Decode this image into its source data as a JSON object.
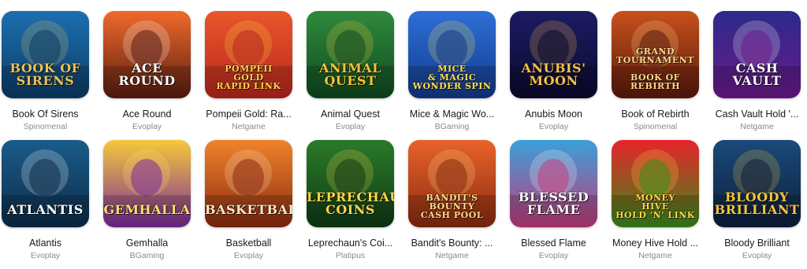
{
  "games": [
    {
      "title": "Book Of Sirens",
      "provider": "Spinomenal",
      "art": "BOOK OF SIRENS",
      "colors": [
        "#1c6fb0",
        "#0a3c66",
        "#e8c15a"
      ]
    },
    {
      "title": "Ace Round",
      "provider": "Evoplay",
      "art": "ACE\nROUND",
      "colors": [
        "#f06a2b",
        "#5a1c10",
        "#ffffff"
      ]
    },
    {
      "title": "Pompeii Gold: Ra...",
      "provider": "Netgame",
      "art": "POMPEII\nGOLD\nRAPID LINK",
      "colors": [
        "#e9572a",
        "#b8261e",
        "#ffd54a"
      ]
    },
    {
      "title": "Animal Quest",
      "provider": "Evoplay",
      "art": "ANIMAL\nQUEST",
      "colors": [
        "#2f8a3c",
        "#0f4a20",
        "#f6c33a"
      ]
    },
    {
      "title": "Mice & Magic Wo...",
      "provider": "BGaming",
      "art": "MICE\n& MAGIC\nWONDER SPIN",
      "colors": [
        "#2d6fd8",
        "#123a8a",
        "#ffe14d"
      ]
    },
    {
      "title": "Anubis Moon",
      "provider": "Evoplay",
      "art": "ANUBIS'\nMOON",
      "colors": [
        "#1d1b63",
        "#0a0a2e",
        "#f5c146"
      ]
    },
    {
      "title": "Book of Rebirth",
      "provider": "Spinomenal",
      "art": "GRAND TOURNAMENT\n\nBOOK OF\nREBIRTH",
      "colors": [
        "#c7501c",
        "#5a1a0c",
        "#ffd98a"
      ]
    },
    {
      "title": "Cash Vault Hold '...",
      "provider": "Netgame",
      "art": "CASH VAULT",
      "colors": [
        "#2b2a8a",
        "#6a1a8a",
        "#ffffff"
      ]
    },
    {
      "title": "Atlantis",
      "provider": "Evoplay",
      "art": "ATLANTIS",
      "colors": [
        "#1a5c8a",
        "#0c2c4a",
        "#ffffff"
      ]
    },
    {
      "title": "Gemhalla",
      "provider": "BGaming",
      "art": "GEMHALLA",
      "colors": [
        "#f5c93a",
        "#7a2a9a",
        "#ffe06a"
      ]
    },
    {
      "title": "Basketball",
      "provider": "Evoplay",
      "art": "BASKETBALL",
      "colors": [
        "#f0832a",
        "#8a2a10",
        "#ffe7c2"
      ]
    },
    {
      "title": "Leprechaun's Coi...",
      "provider": "Platipus",
      "art": "LEPRECHAUN'S\nCOINS",
      "colors": [
        "#2a7a2a",
        "#0e3a14",
        "#ffd34a"
      ]
    },
    {
      "title": "Bandit's Bounty: ...",
      "provider": "Netgame",
      "art": "BANDIT'S\nBOUNTY\nCASH POOL",
      "colors": [
        "#e8632a",
        "#8a2a10",
        "#ffe08a"
      ]
    },
    {
      "title": "Blessed Flame",
      "provider": "Evoplay",
      "art": "BLESSED\nFLAME",
      "colors": [
        "#3aa0d8",
        "#c23a7a",
        "#ffffff"
      ]
    },
    {
      "title": "Money Hive Hold ...",
      "provider": "Netgame",
      "art": "MONEY\nHIVE\nHOLD 'N' LINK",
      "colors": [
        "#e8242a",
        "#3a8a1a",
        "#ffd84a"
      ]
    },
    {
      "title": "Bloody Brilliant",
      "provider": "Evoplay",
      "art": "BLOODY\nBRILLIANT",
      "colors": [
        "#1a4a7a",
        "#0e1e3a",
        "#f5c63a"
      ]
    }
  ]
}
